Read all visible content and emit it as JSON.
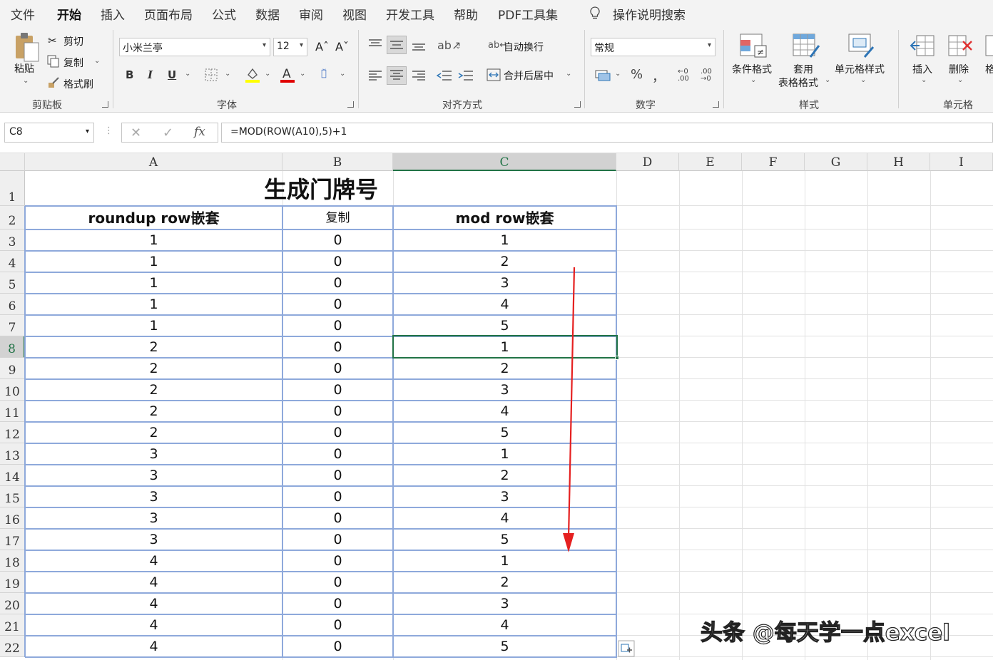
{
  "menu": {
    "tabs": [
      "文件",
      "开始",
      "插入",
      "页面布局",
      "公式",
      "数据",
      "审阅",
      "视图",
      "开发工具",
      "帮助",
      "PDF工具集"
    ],
    "active": "开始",
    "tell_me": "操作说明搜索"
  },
  "ribbon": {
    "clipboard": {
      "paste": "粘贴",
      "cut": "剪切",
      "copy": "复制",
      "format_painter": "格式刷",
      "label": "剪贴板"
    },
    "font": {
      "name": "小米兰亭",
      "size": "12",
      "bold": "B",
      "italic": "I",
      "underline": "U",
      "label": "字体"
    },
    "alignment": {
      "wrap": "自动换行",
      "merge": "合并后居中",
      "label": "对齐方式"
    },
    "number": {
      "format": "常规",
      "percent": "%",
      "comma": "，",
      "label": "数字"
    },
    "styles": {
      "conditional": "条件格式",
      "table_1": "套用",
      "table_2": "表格格式",
      "cell_styles": "单元格样式",
      "label": "样式"
    },
    "cells": {
      "insert": "插入",
      "delete": "删除",
      "format": "格",
      "label": "单元格"
    }
  },
  "formula_bar": {
    "name_box": "C8",
    "formula": "=MOD(ROW(A10),5)+1"
  },
  "sheet": {
    "columns": [
      "A",
      "B",
      "C",
      "D",
      "E",
      "F",
      "G",
      "H",
      "I"
    ],
    "selected_column": "C",
    "selected_row": "8",
    "rows": [
      "1",
      "2",
      "3",
      "4",
      "5",
      "6",
      "7",
      "8",
      "9",
      "10",
      "11",
      "12",
      "13",
      "14",
      "15",
      "16",
      "17",
      "18",
      "19",
      "20",
      "21",
      "22"
    ],
    "title": "生成门牌号",
    "headers": [
      "roundup  row嵌套",
      "复制",
      "mod  row嵌套"
    ],
    "data": [
      [
        "1",
        "0",
        "1"
      ],
      [
        "1",
        "0",
        "2"
      ],
      [
        "1",
        "0",
        "3"
      ],
      [
        "1",
        "0",
        "4"
      ],
      [
        "1",
        "0",
        "5"
      ],
      [
        "2",
        "0",
        "1"
      ],
      [
        "2",
        "0",
        "2"
      ],
      [
        "2",
        "0",
        "3"
      ],
      [
        "2",
        "0",
        "4"
      ],
      [
        "2",
        "0",
        "5"
      ],
      [
        "3",
        "0",
        "1"
      ],
      [
        "3",
        "0",
        "2"
      ],
      [
        "3",
        "0",
        "3"
      ],
      [
        "3",
        "0",
        "4"
      ],
      [
        "3",
        "0",
        "5"
      ],
      [
        "4",
        "0",
        "1"
      ],
      [
        "4",
        "0",
        "2"
      ],
      [
        "4",
        "0",
        "3"
      ],
      [
        "4",
        "0",
        "4"
      ],
      [
        "4",
        "0",
        "5"
      ]
    ]
  },
  "watermark": "头条 @每天学一点excel",
  "colors": {
    "accent": "#217346",
    "table_border": "#8ea9db",
    "arrow": "#e52020"
  }
}
